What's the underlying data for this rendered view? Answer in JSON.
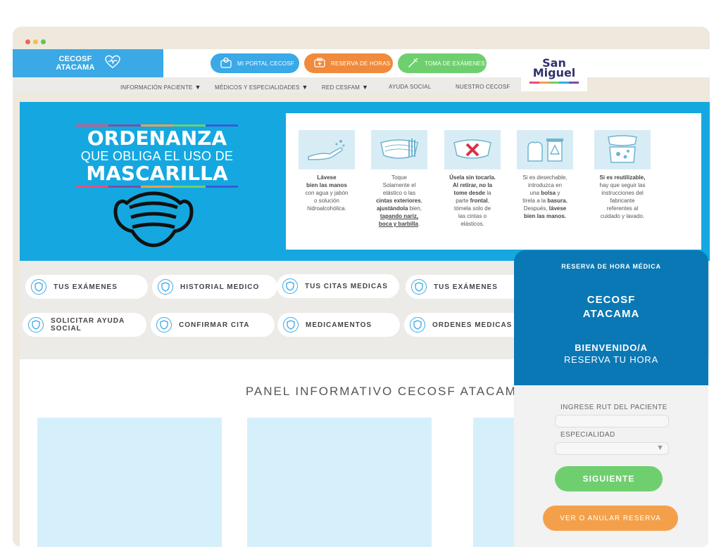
{
  "colors": {
    "brand_blue": "#3aa9e6",
    "orange": "#f08a3c",
    "green": "#6fcf6f",
    "dark_blue": "#0a78b5",
    "banner": "#15a8e0"
  },
  "header": {
    "brand_line1": "CECOSF",
    "brand_line2": "ATACAMA",
    "portal_btn": "MI PORTAL CECOSF",
    "reserva_btn": "RESERVA DE HORAS",
    "examenes_btn": "TOMA DE EXÁMENES",
    "logo_line1": "San",
    "logo_line2": "Miguel"
  },
  "nav": {
    "items": [
      {
        "label": "INFORMACIÓN PACIENTE",
        "dropdown": true
      },
      {
        "label": "MÉDICOS Y ESPECIALIDADES",
        "dropdown": true
      },
      {
        "label": "RED CESFAM",
        "dropdown": true
      },
      {
        "label": "AYUDA SOCIAL",
        "dropdown": false
      },
      {
        "label": "NUESTRO CECOSF",
        "dropdown": false
      }
    ]
  },
  "banner": {
    "line1": "ORDENANZA",
    "line2": "QUE OBLIGA EL USO DE",
    "line3": "MASCARILLA",
    "steps": [
      {
        "icon": "hand-wash-icon",
        "text_html": "<b>Lávese<br>bien las manos</b><br>con agua y jabón<br>o solución<br>hidroalcohólica."
      },
      {
        "icon": "mask-hand-icon",
        "text_html": "Toque<br>Solamente el<br>elástico o las<br><b>cintas exteriores</b>,<br><b>ajustándola</b> bien,<br><b><u>tapando nariz,</u></b><br><b><u>boca y barbilla</u></b>."
      },
      {
        "icon": "mask-no-touch-icon",
        "text_html": "<b>Úsela sin tocarla.<br>Al retirar, no la<br>tome desde</b> la<br>parte <b>frontal</b>,<br>tómela solo de<br>las cintas o<br>elásticos."
      },
      {
        "icon": "trash-bin-icon",
        "text_html": "Si es desechable,<br>introduzca en<br>una <b>bolsa</b> y<br>tírela a la <b>basura.</b><br>Después, <b>lávese<br>bien las manos.</b>"
      },
      {
        "icon": "mask-wash-icon",
        "text_html": "<b>Si es reutilizable,</b><br>hay que seguir las<br>instrucciones del<br>fabricante<br>referentes al<br>cuidado y lavado."
      }
    ]
  },
  "quick_links": [
    {
      "label": "TUS EXÁMENES"
    },
    {
      "label": "HISTORIAL MEDICO"
    },
    {
      "label": "TUS CITAS MEDICAS"
    },
    {
      "label": "TUS EXÁMENES"
    },
    {
      "label": "SOLICITAR AYUDA SOCIAL"
    },
    {
      "label": "CONFIRMAR CITA"
    },
    {
      "label": "MEDICAMENTOS"
    },
    {
      "label": "ORDENES MEDICAS"
    }
  ],
  "panel": {
    "title": "PANEL INFORMATIVO CECOSF ATACAMA"
  },
  "booking": {
    "header": "RESERVA DE HORA MÉDICA",
    "center_line1": "CECOSF",
    "center_line2": "ATACAMA",
    "welcome": "BIENVENIDO/A",
    "subtitle": "RESERVA TU HORA",
    "rut_label": "INGRESE RUT DEL PACIENTE",
    "rut_value": "",
    "specialty_label": "ESPECIALIDAD",
    "specialty_value": "",
    "next_btn": "SIGUIENTE",
    "cancel_btn": "VER O ANULAR RESERVA"
  }
}
